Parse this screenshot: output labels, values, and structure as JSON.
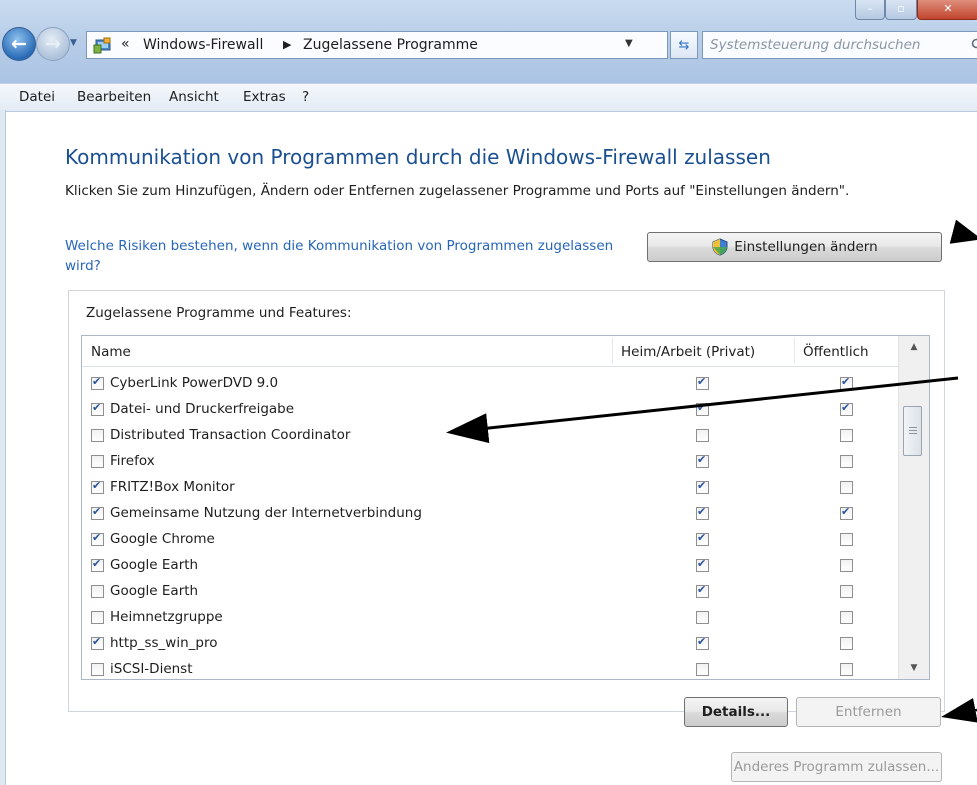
{
  "window": {
    "address": {
      "overflow_chevron": "«",
      "crumbs": [
        "Windows-Firewall",
        "Zugelassene Programme"
      ]
    },
    "search_placeholder": "Systemsteuerung durchsuchen"
  },
  "menu": [
    "Datei",
    "Bearbeiten",
    "Ansicht",
    "Extras",
    "?"
  ],
  "content": {
    "title": "Kommunikation von Programmen durch die Windows-Firewall zulassen",
    "description": "Klicken Sie zum Hinzufügen, Ändern oder Entfernen zugelassener Programme und Ports auf \"Einstellungen ändern\".",
    "risk_link": "Welche Risiken bestehen, wenn die Kommunikation von Programmen zugelassen wird?",
    "settings_button": "Einstellungen ändern",
    "group_label": "Zugelassene Programme und Features:",
    "columns": {
      "name": "Name",
      "private": "Heim/Arbeit (Privat)",
      "public": "Öffentlich"
    },
    "programs": [
      {
        "name": "CyberLink PowerDVD 9.0",
        "enabled": true,
        "private": true,
        "public": true
      },
      {
        "name": "Datei- und Druckerfreigabe",
        "enabled": true,
        "private": true,
        "public": true
      },
      {
        "name": "Distributed Transaction Coordinator",
        "enabled": false,
        "private": false,
        "public": false
      },
      {
        "name": "Firefox",
        "enabled": false,
        "private": true,
        "public": false
      },
      {
        "name": "FRITZ!Box Monitor",
        "enabled": true,
        "private": true,
        "public": false
      },
      {
        "name": "Gemeinsame Nutzung der Internetverbindung",
        "enabled": true,
        "private": true,
        "public": true
      },
      {
        "name": "Google Chrome",
        "enabled": true,
        "private": true,
        "public": false
      },
      {
        "name": "Google Earth",
        "enabled": true,
        "private": true,
        "public": false
      },
      {
        "name": "Google Earth",
        "enabled": false,
        "private": true,
        "public": false
      },
      {
        "name": "Heimnetzgruppe",
        "enabled": false,
        "private": false,
        "public": false
      },
      {
        "name": "http_ss_win_pro",
        "enabled": true,
        "private": true,
        "public": false
      },
      {
        "name": "iSCSI-Dienst",
        "enabled": false,
        "private": false,
        "public": false
      }
    ],
    "details_button": "Details...",
    "remove_button": "Entfernen",
    "other_program_button": "Anderes Programm zulassen..."
  },
  "icons": {
    "back": "back-arrow-icon",
    "forward": "forward-arrow-icon",
    "address": "control-panel-icon",
    "refresh": "refresh-icon",
    "search": "search-icon",
    "shield": "uac-shield-icon",
    "checkbox_check": "✔"
  },
  "colors": {
    "title": "#1a4f92",
    "link": "#2766b9",
    "chrome": "#b7cde8",
    "close_button": "#c2452d"
  }
}
